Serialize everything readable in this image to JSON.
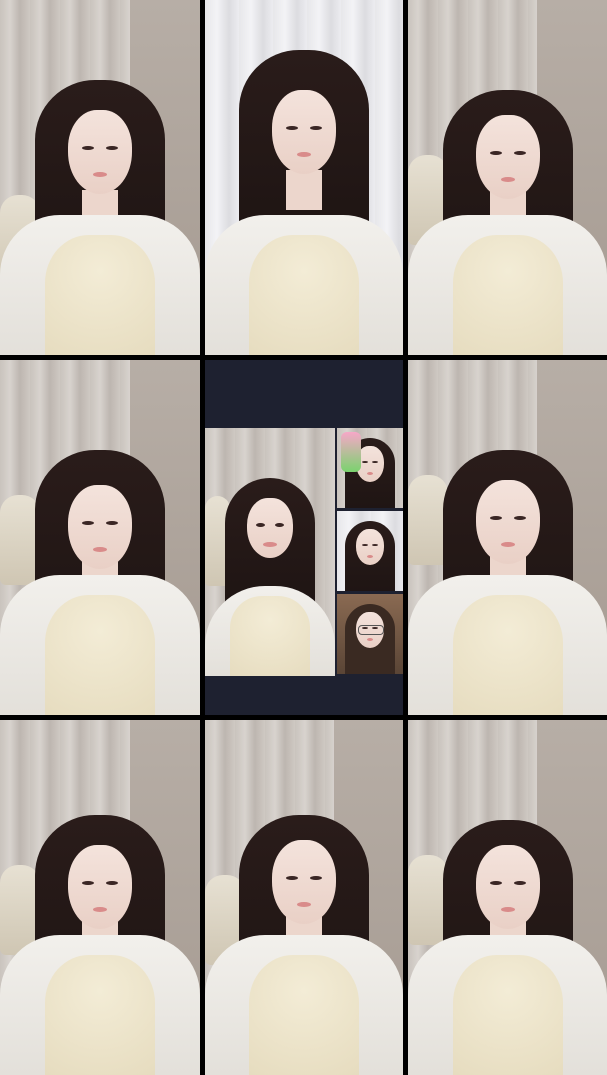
{
  "grid": {
    "tiles": [
      {
        "id": "tile-1",
        "curtain": "warm"
      },
      {
        "id": "tile-2",
        "curtain": "light"
      },
      {
        "id": "tile-3",
        "curtain": "warm"
      },
      {
        "id": "tile-4",
        "curtain": "warm"
      },
      {
        "id": "tile-5",
        "curtain": "multi"
      },
      {
        "id": "tile-6",
        "curtain": "warm"
      },
      {
        "id": "tile-7",
        "curtain": "warm"
      },
      {
        "id": "tile-8",
        "curtain": "warm"
      },
      {
        "id": "tile-9",
        "curtain": "warm"
      }
    ],
    "colors": {
      "background": "#000000",
      "center_panel": "#1e2130",
      "hair": "#1a1211",
      "top": "#efe6cf",
      "cardigan": "#eceae5"
    }
  }
}
